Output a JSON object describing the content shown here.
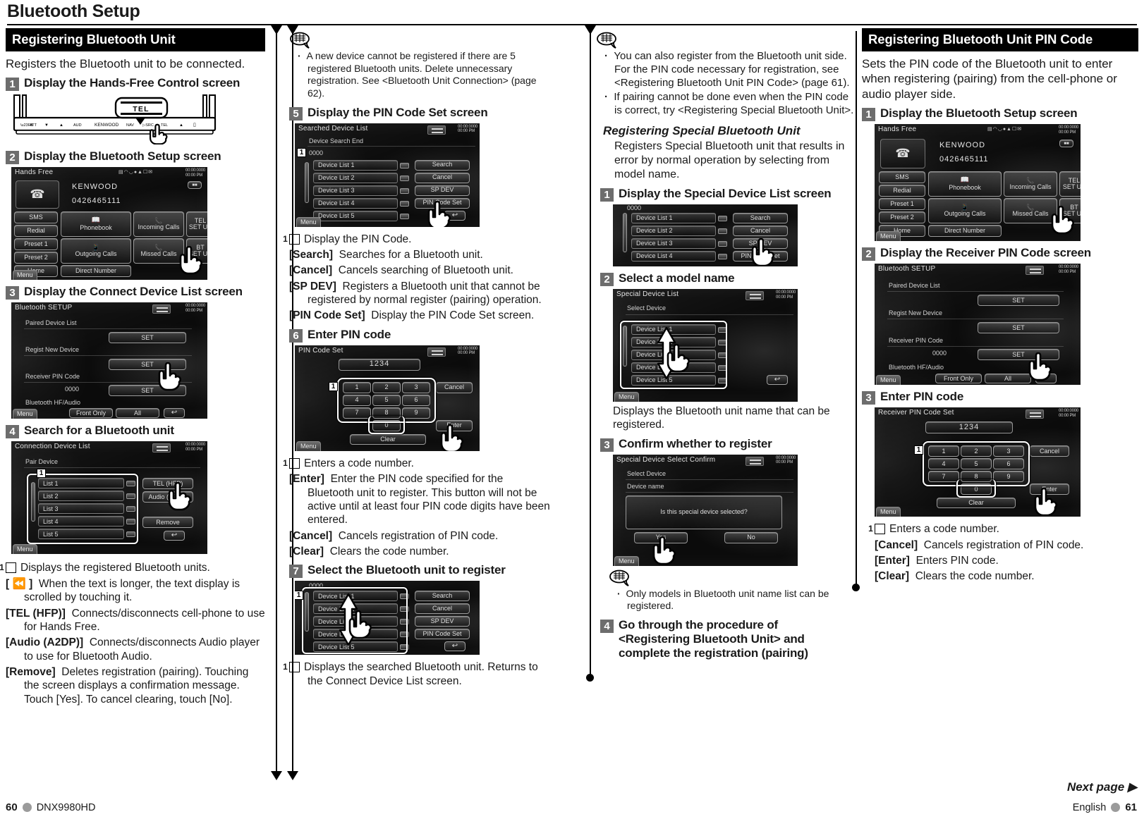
{
  "page": {
    "title": "Bluetooth Setup",
    "next_page": "Next page ▶",
    "footer_left_page": "60",
    "footer_left_model": "DNX9980HD",
    "footer_right_lang": "English",
    "footer_right_page": "61"
  },
  "col1": {
    "section_title": "Registering Bluetooth Unit",
    "lead": "Registers the Bluetooth unit to be connected.",
    "steps": [
      {
        "num": "1",
        "text": "Display the Hands-Free Control screen"
      },
      {
        "num": "2",
        "text": "Display the Bluetooth Setup screen"
      },
      {
        "num": "3",
        "text": "Display the Connect Device List screen"
      },
      {
        "num": "4",
        "text": "Search for a Bluetooth unit"
      }
    ],
    "faceplate": {
      "button_label": "TEL",
      "keys": [
        "ATT",
        "▼",
        "▲",
        "AUD",
        "KENWOOD",
        "NAV",
        "SRC",
        "TEL",
        "⏏",
        "▭"
      ]
    },
    "items": [
      {
        "boxnum": "1",
        "tag": "",
        "text": "Displays the registered Bluetooth units."
      },
      {
        "boxnum": "",
        "tag": "[ ⏪ ]",
        "text": "When the text is longer, the text display is scrolled by touching it."
      },
      {
        "boxnum": "",
        "tag": "[TEL (HFP)]",
        "text": "Connects/disconnects cell-phone to use for Hands Free."
      },
      {
        "boxnum": "",
        "tag": "[Audio (A2DP)]",
        "text": "Connects/disconnects Audio player to use for Bluetooth Audio."
      },
      {
        "boxnum": "",
        "tag": "[Remove]",
        "text": "Deletes registration (pairing). Touching the screen displays a confirmation message. Touch [Yes]. To cancel clearing, touch [No]."
      }
    ],
    "lcd_handsfree": {
      "title": "Hands Free",
      "device_name": "KENWOOD",
      "device_number": "0426465111",
      "clock": "00:00:0000\n00:00 PM",
      "left_buttons": [
        "SMS",
        "Redial",
        "Preset 1",
        "Preset 2",
        "Home"
      ],
      "grid_buttons": [
        "Phonebook",
        "Incoming Calls",
        "TEL\nSET UP",
        "Outgoing Calls",
        "Missed Calls",
        "BT\nSET UP"
      ],
      "direct_number": "Direct Number",
      "menu": "Menu"
    },
    "lcd_btsetup": {
      "title": "Bluetooth SETUP",
      "clock": "00:00:0000\n00:00 PM",
      "rows": [
        {
          "label": "Paired Device List",
          "value": "",
          "button": "SET"
        },
        {
          "label": "Regist New Device",
          "value": "",
          "button": "SET"
        },
        {
          "label": "Receiver PIN Code",
          "value": "0000",
          "button": "SET"
        }
      ],
      "hf_audio_label": "Bluetooth HF/Audio",
      "hf_audio_buttons": [
        "Front Only",
        "All"
      ],
      "menu": "Menu"
    },
    "lcd_connlist": {
      "title": "Connection Device List",
      "subtitle": "Pair Device",
      "clock": "00:00:0000\n00:00 PM",
      "list": [
        "List 1",
        "List 2",
        "List 3",
        "List 4",
        "List 5"
      ],
      "buttons": [
        "TEL (HFP)",
        "Audio (A2DP)",
        "Remove"
      ],
      "callout": "1",
      "menu": "Menu"
    }
  },
  "col2": {
    "note1": [
      "A new device cannot be registered if there are 5 registered Bluetooth units. Delete unnecessary registration.  See <Bluetooth Unit Connection> (page 62)."
    ],
    "steps": [
      {
        "num": "5",
        "text": "Display the PIN Code Set screen"
      },
      {
        "num": "6",
        "text": "Enter PIN code"
      },
      {
        "num": "7",
        "text": "Select the Bluetooth unit to register"
      }
    ],
    "items_after_5": [
      {
        "boxnum": "1",
        "tag": "",
        "text": "Display the PIN Code."
      },
      {
        "boxnum": "",
        "tag": "[Search]",
        "text": "Searches for a Bluetooth unit."
      },
      {
        "boxnum": "",
        "tag": "[Cancel]",
        "text": "Cancels searching of Bluetooth unit."
      },
      {
        "boxnum": "",
        "tag": "[SP DEV]",
        "text": "Registers a Bluetooth unit that cannot be registered by normal register (pairing) operation."
      },
      {
        "boxnum": "",
        "tag": "[PIN Code Set]",
        "text": "Display the PIN Code Set screen."
      }
    ],
    "items_after_6": [
      {
        "boxnum": "1",
        "tag": "",
        "text": "Enters a code number."
      },
      {
        "boxnum": "",
        "tag": "[Enter]",
        "text": "Enter the PIN code specified for the Bluetooth unit to register. This button will not be active until at least four PIN code digits have been entered."
      },
      {
        "boxnum": "",
        "tag": "[Cancel]",
        "text": "Cancels registration of PIN code."
      },
      {
        "boxnum": "",
        "tag": "[Clear]",
        "text": "Clears the code number."
      }
    ],
    "items_after_7": [
      {
        "boxnum": "1",
        "tag": "",
        "text": "Displays the searched Bluetooth unit. Returns to the Connect Device List screen."
      }
    ],
    "lcd_searched": {
      "title": "Searched Device List",
      "subtitle": "Device Search End",
      "pin": "0000",
      "clock": "00:00:0000\n00:00 PM",
      "list": [
        "Device List 1",
        "Device List 2",
        "Device List 3",
        "Device List 4",
        "Device List 5"
      ],
      "buttons": [
        "Search",
        "Cancel",
        "SP DEV",
        "PIN Code Set"
      ],
      "callout": "1",
      "menu": "Menu"
    },
    "lcd_pincode": {
      "title": "PIN Code Set",
      "code": "1234",
      "clock": "00:00:0000\n00:00 PM",
      "keys": [
        "1",
        "2",
        "3",
        "4",
        "5",
        "6",
        "7",
        "8",
        "9",
        "0"
      ],
      "buttons": [
        "Cancel",
        "Enter",
        "Clear"
      ],
      "callout": "1",
      "menu": "Menu"
    },
    "lcd_select": {
      "pin": "0000",
      "list": [
        "Device List 1",
        "Device List 2",
        "Device List 3",
        "Device List 4",
        "Device List 5"
      ],
      "buttons": [
        "Search",
        "Cancel",
        "SP DEV",
        "PIN Code Set"
      ],
      "callout": "1"
    }
  },
  "col3": {
    "note1": [
      "You can also register from the Bluetooth unit side. For the PIN code necessary for registration, see <Registering Bluetooth Unit PIN Code> (page 61).",
      "If pairing cannot be done even when the PIN code is correct, try <Registering Special Bluetooth Unit>."
    ],
    "sub_head": "Registering Special Bluetooth Unit",
    "sub_body": "Registers Special Bluetooth unit that results in error by normal operation by selecting from model name.",
    "steps": [
      {
        "num": "1",
        "text": "Display the Special Device List screen"
      },
      {
        "num": "2",
        "text": "Select a model name"
      },
      {
        "num": "3",
        "text": "Confirm whether to register"
      },
      {
        "num": "4",
        "text": "Go through the procedure of <Registering Bluetooth Unit> and complete the registration (pairing)"
      }
    ],
    "after_step2": "Displays the Bluetooth unit name that can be registered.",
    "note2": [
      "Only models in Bluetooth unit name list can be registered."
    ],
    "lcd_spdev": {
      "pin": "0000",
      "list": [
        "Device List 1",
        "Device List 2",
        "Device List 3",
        "Device List 4"
      ],
      "buttons": [
        "Search",
        "Cancel",
        "SP DEV",
        "PIN Code Set"
      ]
    },
    "lcd_speciallist": {
      "title": "Special Device List",
      "subtitle": "Select Device",
      "clock": "00:00:0000\n00:00 PM",
      "list": [
        "Device List 1",
        "Device List 2",
        "Device List 3",
        "Device List 4",
        "Device List 5"
      ],
      "menu": "Menu"
    },
    "lcd_confirm": {
      "title": "Special Device Select Confirm",
      "subtitle": "Select Device",
      "device_name_label": "Device name",
      "clock": "00:00:0000\n00:00 PM",
      "message": "Is this special device selected?",
      "buttons": [
        "Yes",
        "No"
      ],
      "menu": "Menu"
    }
  },
  "col4": {
    "section_title": "Registering Bluetooth Unit PIN Code",
    "lead": "Sets the PIN code of the Bluetooth unit to enter when registering (pairing) from the cell-phone or audio player side.",
    "steps": [
      {
        "num": "1",
        "text": "Display the Bluetooth Setup screen"
      },
      {
        "num": "2",
        "text": "Display the Receiver PIN Code screen"
      },
      {
        "num": "3",
        "text": "Enter PIN code"
      }
    ],
    "items": [
      {
        "boxnum": "1",
        "tag": "",
        "text": "Enters a code number."
      },
      {
        "boxnum": "",
        "tag": "[Cancel]",
        "text": "Cancels registration of PIN code."
      },
      {
        "boxnum": "",
        "tag": "[Enter]",
        "text": "Enters PIN code."
      },
      {
        "boxnum": "",
        "tag": "[Clear]",
        "text": "Clears the code number."
      }
    ],
    "lcd_handsfree": {
      "title": "Hands Free",
      "device_name": "KENWOOD",
      "device_number": "0426465111",
      "clock": "00:00:0000\n00:00 PM",
      "left_buttons": [
        "SMS",
        "Redial",
        "Preset 1",
        "Preset 2",
        "Home"
      ],
      "grid_buttons": [
        "Phonebook",
        "Incoming Calls",
        "TEL\nSET UP",
        "Outgoing Calls",
        "Missed Calls",
        "BT\nSET UP"
      ],
      "direct_number": "Direct Number",
      "menu": "Menu"
    },
    "lcd_btsetup": {
      "title": "Bluetooth SETUP",
      "clock": "00:00:0000\n00:00 PM",
      "rows": [
        {
          "label": "Paired Device List",
          "value": "",
          "button": "SET"
        },
        {
          "label": "Regist New Device",
          "value": "",
          "button": "SET"
        },
        {
          "label": "Receiver PIN Code",
          "value": "0000",
          "button": "SET"
        }
      ],
      "hf_audio_label": "Bluetooth HF/Audio",
      "hf_audio_buttons": [
        "Front Only",
        "All"
      ],
      "menu": "Menu"
    },
    "lcd_receiverpin": {
      "title": "Receiver PIN Code Set",
      "code": "1234",
      "clock": "00:00:0000\n00:00 PM",
      "keys": [
        "1",
        "2",
        "3",
        "4",
        "5",
        "6",
        "7",
        "8",
        "9",
        "0"
      ],
      "buttons": [
        "Cancel",
        "Enter",
        "Clear"
      ],
      "callout": "1",
      "menu": "Menu"
    }
  }
}
